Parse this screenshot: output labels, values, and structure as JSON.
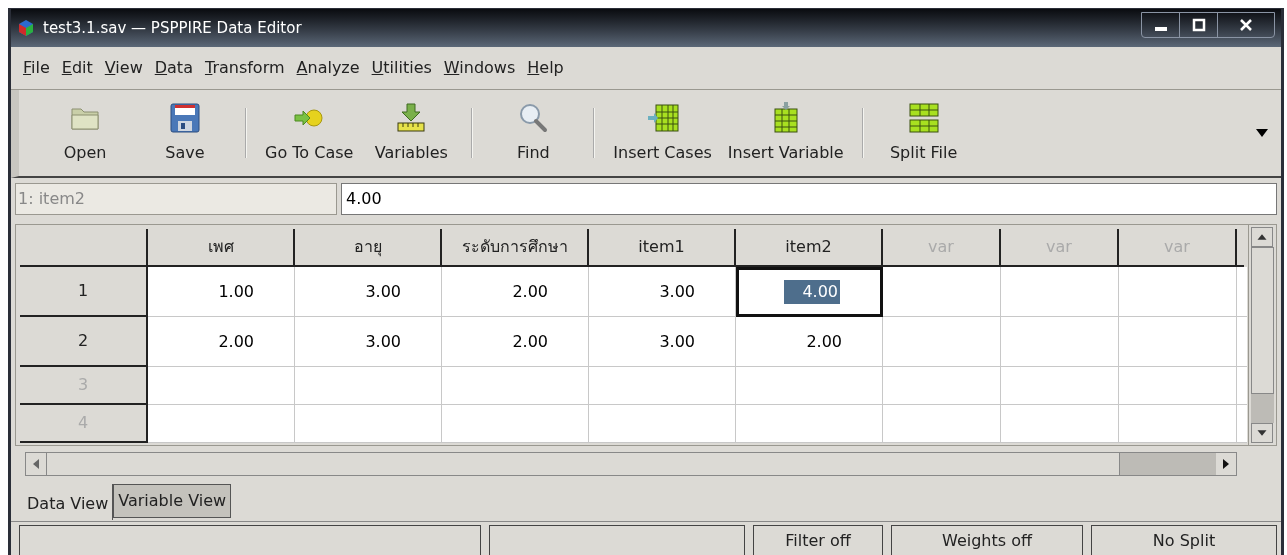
{
  "window": {
    "title": "test3.1.sav — PSPPIRE Data Editor"
  },
  "menu": [
    "File",
    "Edit",
    "View",
    "Data",
    "Transform",
    "Analyze",
    "Utilities",
    "Windows",
    "Help"
  ],
  "toolbar_groups": [
    {
      "items": [
        {
          "label": "Open",
          "kind": "open"
        },
        {
          "label": "Save",
          "kind": "save"
        }
      ]
    },
    {
      "items": [
        {
          "label": "Go To Case",
          "kind": "goto"
        },
        {
          "label": "Variables",
          "kind": "variables"
        }
      ]
    },
    {
      "items": [
        {
          "label": "Find",
          "kind": "find"
        }
      ]
    },
    {
      "items": [
        {
          "label": "Insert Cases",
          "kind": "insert-cases"
        },
        {
          "label": "Insert Variable",
          "kind": "insert-variable"
        }
      ]
    },
    {
      "items": [
        {
          "label": "Split File",
          "kind": "split"
        }
      ]
    }
  ],
  "cell_ref": {
    "name": "1: item2",
    "value": "4.00"
  },
  "table": {
    "columns": [
      {
        "name": "เพศ",
        "defined": true
      },
      {
        "name": "อายุ",
        "defined": true
      },
      {
        "name": "ระดับการศึกษา",
        "defined": true
      },
      {
        "name": "item1",
        "defined": true
      },
      {
        "name": "item2",
        "defined": true
      },
      {
        "name": "var",
        "defined": false
      },
      {
        "name": "var",
        "defined": false
      },
      {
        "name": "var",
        "defined": false
      }
    ],
    "rows": [
      {
        "label": "1",
        "defined": true,
        "cells": [
          {
            "value": "1.00",
            "selected": false
          },
          {
            "value": "3.00",
            "selected": false
          },
          {
            "value": "2.00",
            "selected": false
          },
          {
            "value": "3.00",
            "selected": false
          },
          {
            "value": "4.00",
            "selected": true
          }
        ]
      },
      {
        "label": "2",
        "defined": true,
        "cells": [
          {
            "value": "2.00",
            "selected": false
          },
          {
            "value": "3.00",
            "selected": false
          },
          {
            "value": "2.00",
            "selected": false
          },
          {
            "value": "3.00",
            "selected": false
          },
          {
            "value": "2.00",
            "selected": false
          }
        ]
      },
      {
        "label": "3",
        "defined": false
      },
      {
        "label": "4",
        "defined": false
      }
    ]
  },
  "tabs": [
    {
      "label": "Data View",
      "selected": true
    },
    {
      "label": "Variable View",
      "selected": false
    }
  ],
  "status_bar": [
    "Filter off",
    "Weights off",
    "No Split"
  ]
}
